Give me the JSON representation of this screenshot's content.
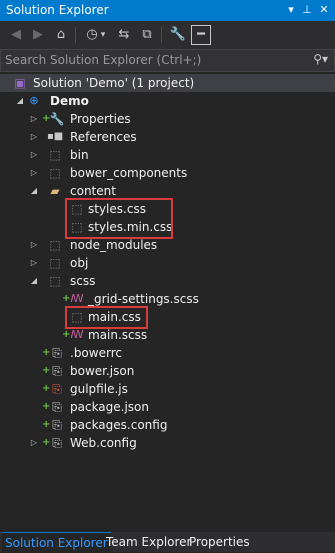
{
  "window": {
    "title": "Solution Explorer"
  },
  "search": {
    "placeholder": "Search Solution Explorer (Ctrl+;)"
  },
  "tree": {
    "solution": "Solution 'Demo' (1 project)",
    "project": "Demo",
    "properties": "Properties",
    "references": "References",
    "bin": "bin",
    "bower_components": "bower_components",
    "content": "content",
    "styles_css": "styles.css",
    "styles_min_css": "styles.min.css",
    "node_modules": "node_modules",
    "obj": "obj",
    "scss": "scss",
    "grid_settings": "_grid-settings.scss",
    "main_css": "main.css",
    "main_scss": "main.scss",
    "bowerrc": ".bowerrc",
    "bower_json": "bower.json",
    "gulpfile": "gulpfile.js",
    "package_json": "package.json",
    "packages_config": "packages.config",
    "web_config": "Web.config"
  },
  "tabs": [
    "Solution Explorer",
    "Team Explorer",
    "Properties"
  ],
  "colors": {
    "accent": "#007acc",
    "highlight_box": "#d83b3b",
    "folder": "#dcb67a",
    "add_marker": "#6cbd45"
  }
}
